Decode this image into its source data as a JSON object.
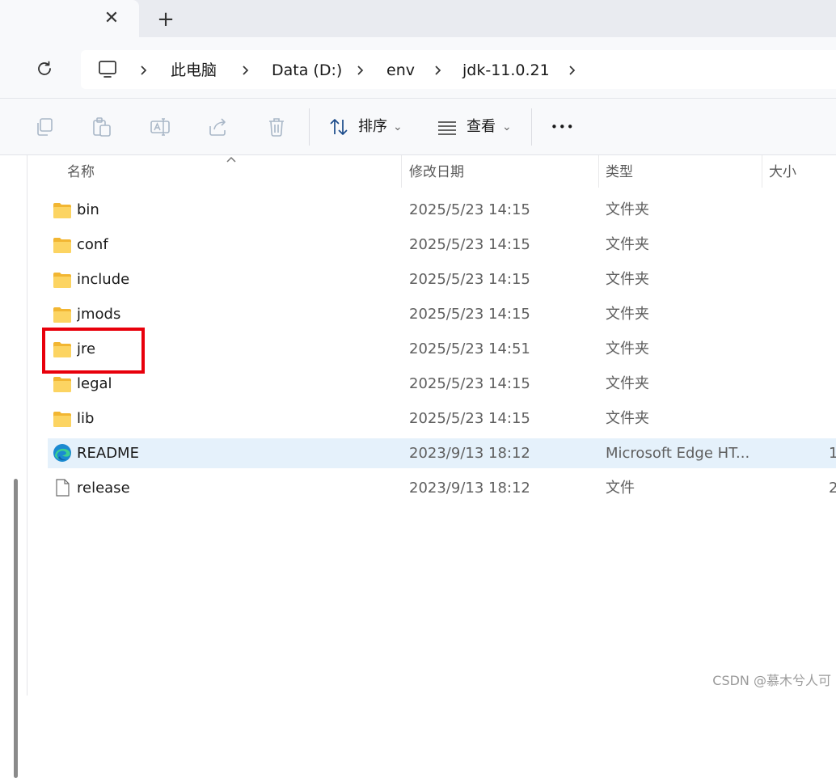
{
  "tabs": {
    "close_glyph": "✕",
    "new_tab_glyph": "+"
  },
  "address_bar": {
    "breadcrumb": [
      "此电脑",
      "Data (D:)",
      "env",
      "jdk-11.0.21"
    ]
  },
  "toolbar": {
    "sort_label": "排序",
    "view_label": "查看",
    "more_glyph": "•••",
    "dropdown_glyph": "⌄"
  },
  "columns": {
    "name": "名称",
    "date": "修改日期",
    "type": "类型",
    "size": "大小"
  },
  "files": [
    {
      "name": "bin",
      "date": "2025/5/23 14:15",
      "type": "文件夹",
      "icon": "folder-icon"
    },
    {
      "name": "conf",
      "date": "2025/5/23 14:15",
      "type": "文件夹",
      "icon": "folder-icon"
    },
    {
      "name": "include",
      "date": "2025/5/23 14:15",
      "type": "文件夹",
      "icon": "folder-icon"
    },
    {
      "name": "jmods",
      "date": "2025/5/23 14:15",
      "type": "文件夹",
      "icon": "folder-icon"
    },
    {
      "name": "jre",
      "date": "2025/5/23 14:51",
      "type": "文件夹",
      "icon": "folder-icon"
    },
    {
      "name": "legal",
      "date": "2025/5/23 14:15",
      "type": "文件夹",
      "icon": "folder-icon"
    },
    {
      "name": "lib",
      "date": "2025/5/23 14:15",
      "type": "文件夹",
      "icon": "folder-icon"
    },
    {
      "name": "README",
      "date": "2023/9/13 18:12",
      "type": "Microsoft Edge HT...",
      "size": "1",
      "icon": "edge-icon",
      "selected": true
    },
    {
      "name": "release",
      "date": "2023/9/13 18:12",
      "type": "文件",
      "size": "2",
      "icon": "file-icon"
    }
  ],
  "watermark": "CSDN @慕木兮人可",
  "colors": {
    "accent_highlight": "#e8000b",
    "selected_row": "#e5f1fb",
    "folder": "#f8c94a"
  }
}
